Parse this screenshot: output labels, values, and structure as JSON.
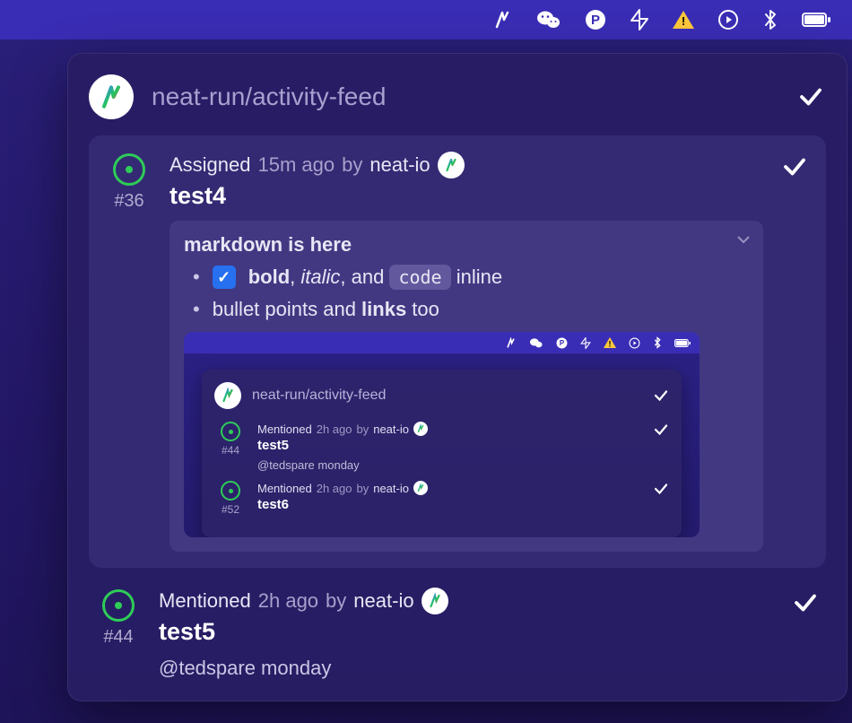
{
  "menubar": {
    "icons": [
      "neat-icon",
      "wechat-icon",
      "p-circle-icon",
      "supabase-icon",
      "warning-icon",
      "play-circle-icon",
      "bluetooth-icon",
      "battery-icon"
    ]
  },
  "header": {
    "repo": "neat-run/activity-feed"
  },
  "item1": {
    "action": "Assigned",
    "time": "15m ago",
    "by_label": "by",
    "author": "neat-io",
    "issue_number": "#36",
    "title": "test4",
    "markdown": {
      "heading": "markdown is here",
      "bullets": {
        "b1_bold": "bold",
        "b1_sep1": ", ",
        "b1_italic": "italic",
        "b1_sep2": ", and ",
        "b1_code": "code",
        "b1_tail": " inline",
        "b2_pre": "bullet points and ",
        "b2_bold": "links",
        "b2_tail": " too"
      }
    }
  },
  "embed": {
    "header": {
      "repo": "neat-run/activity-feed"
    },
    "items": [
      {
        "action": "Mentioned",
        "time": "2h ago",
        "by_label": "by",
        "author": "neat-io",
        "issue_number": "#44",
        "title": "test5",
        "comment": "@tedspare monday"
      },
      {
        "action": "Mentioned",
        "time": "2h ago",
        "by_label": "by",
        "author": "neat-io",
        "issue_number": "#52",
        "title": "test6"
      }
    ]
  },
  "item2": {
    "action": "Mentioned",
    "time": "2h ago",
    "by_label": "by",
    "author": "neat-io",
    "issue_number": "#44",
    "title": "test5",
    "comment": "@tedspare monday"
  }
}
